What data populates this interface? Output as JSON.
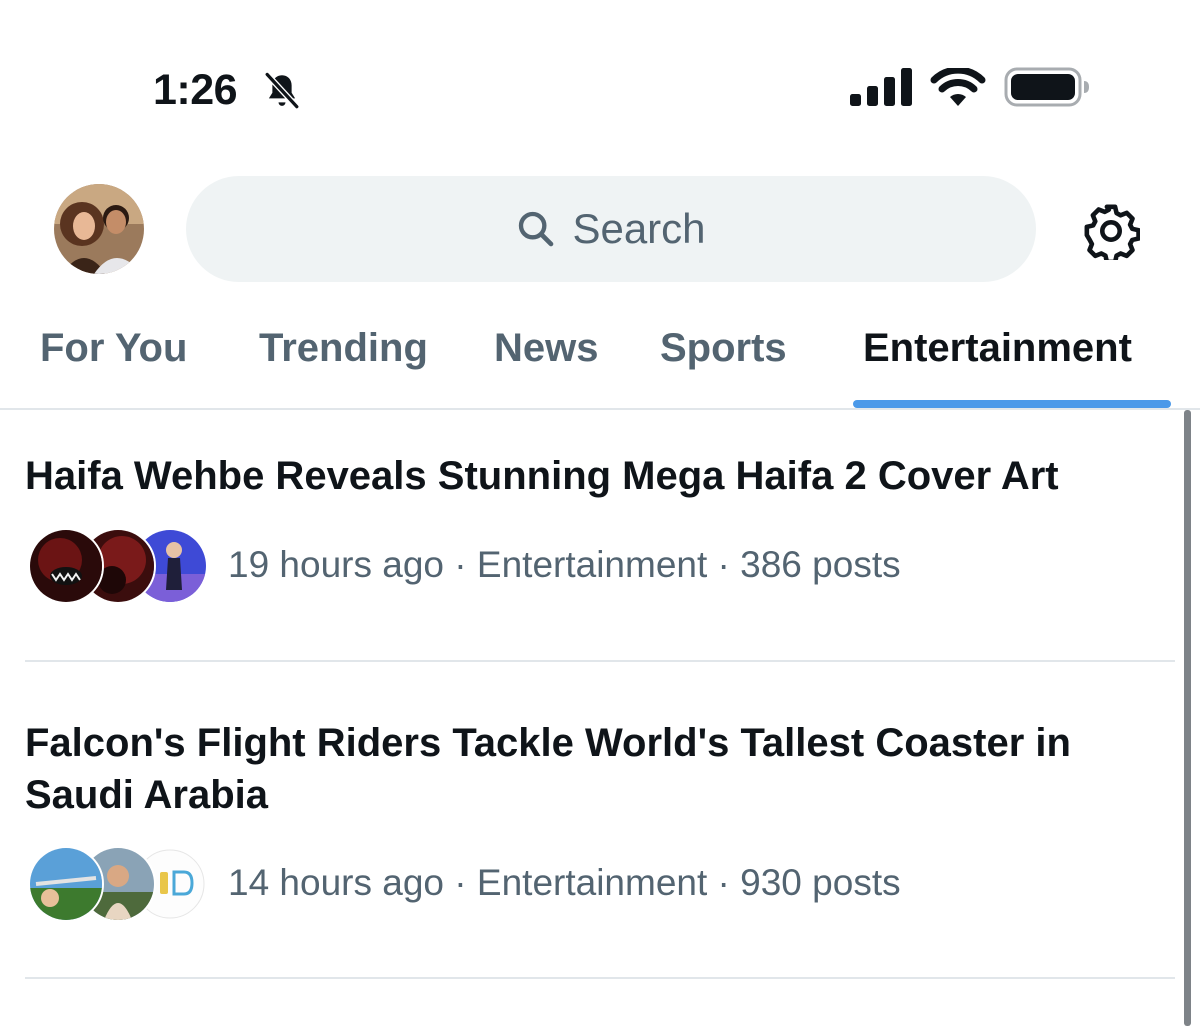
{
  "status_bar": {
    "time": "1:26",
    "icons": [
      "bell-slash-icon",
      "cellular-signal-icon",
      "wifi-icon",
      "battery-icon"
    ]
  },
  "header": {
    "search": {
      "placeholder": "Search",
      "icon": "search-icon"
    },
    "settings_icon": "gear-icon"
  },
  "tabs": [
    {
      "label": "For You",
      "active": false
    },
    {
      "label": "Trending",
      "active": false
    },
    {
      "label": "News",
      "active": false
    },
    {
      "label": "Sports",
      "active": false
    },
    {
      "label": "Entertainment",
      "active": true
    }
  ],
  "accent_color": "#4b99e9",
  "items": [
    {
      "title": "Haifa Wehbe Reveals Stunning Mega Haifa 2 Cover Art",
      "time": "19 hours ago",
      "category": "Entertainment",
      "posts": "386 posts"
    },
    {
      "title": "Falcon's Flight Riders Tackle World's Tallest Coaster in Saudi Arabia",
      "time": "14 hours ago",
      "category": "Entertainment",
      "posts": "930 posts"
    }
  ],
  "separator": " · "
}
